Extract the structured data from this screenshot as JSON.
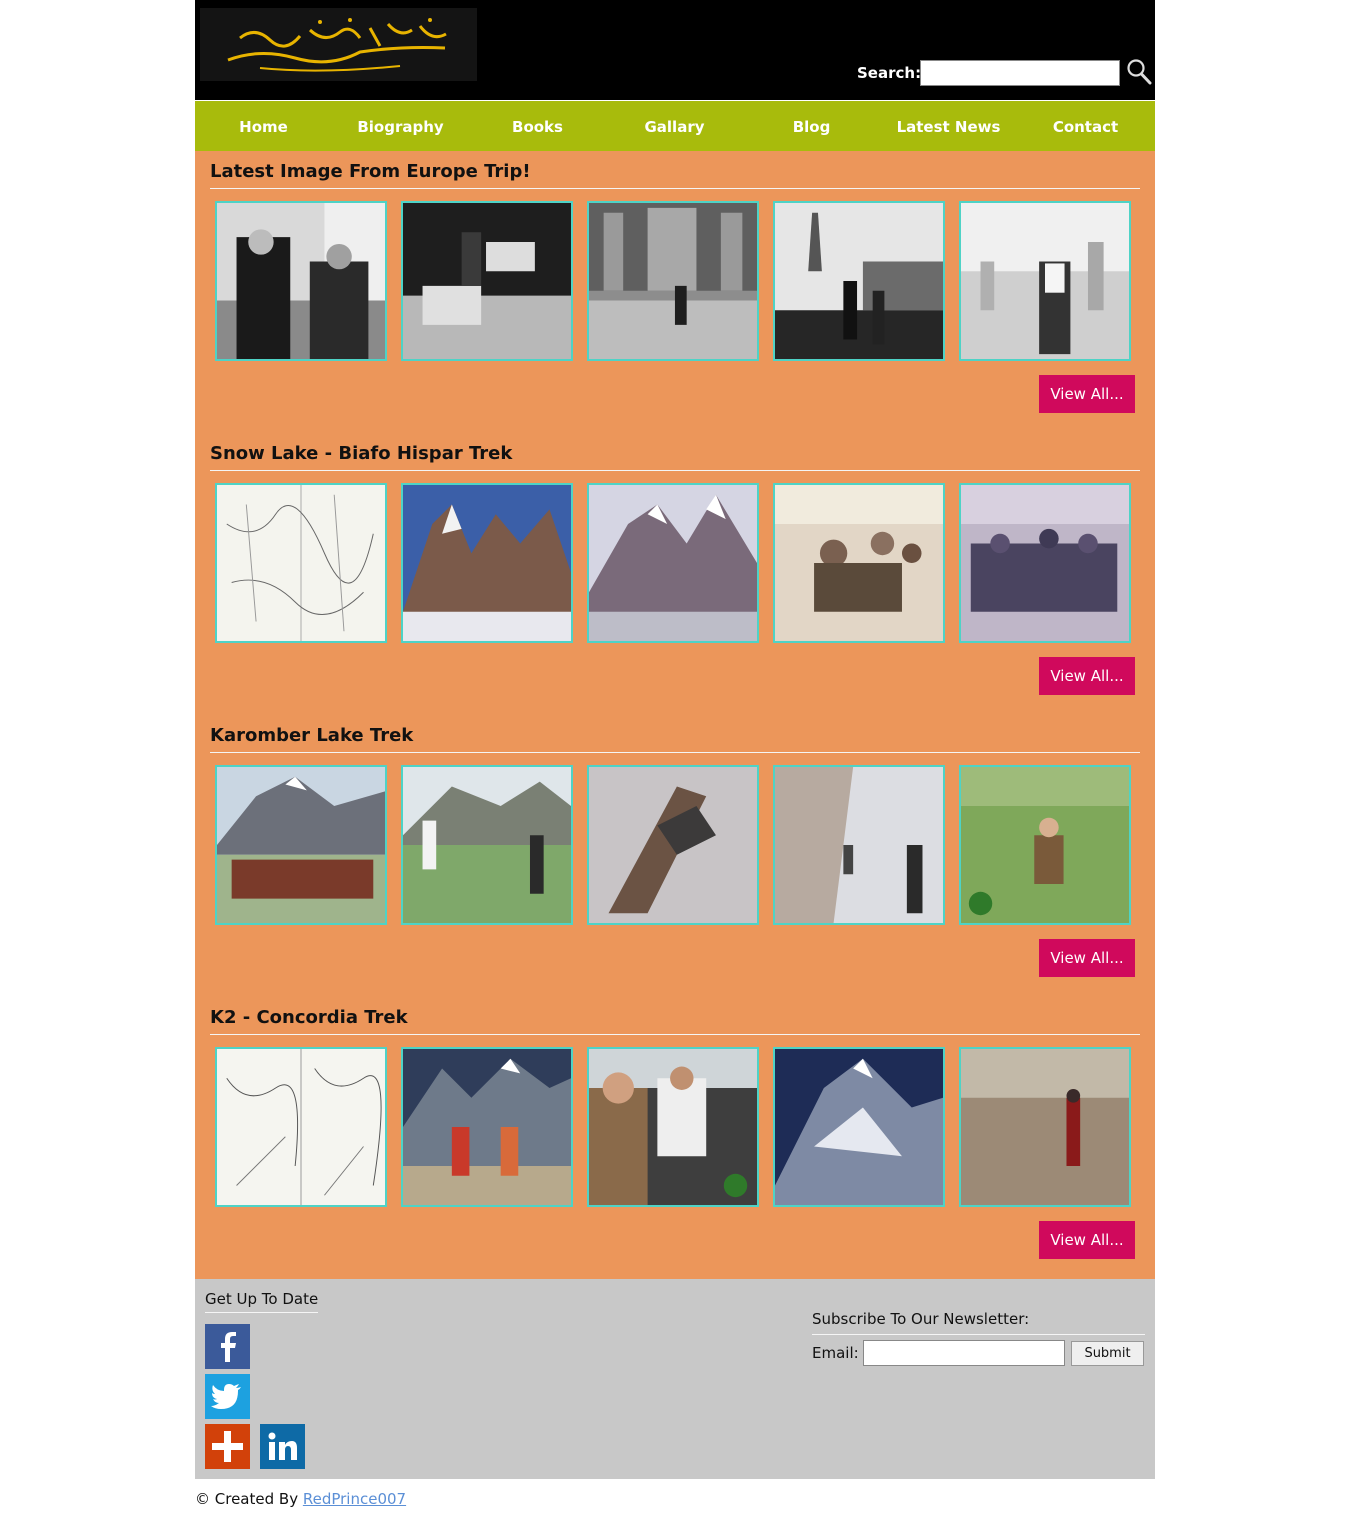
{
  "header": {
    "logo_alt": "مستنصر حسین تارڑ",
    "search_label": "Search:",
    "search_value": ""
  },
  "nav": {
    "items": [
      "Home",
      "Biography",
      "Books",
      "Gallary",
      "Blog",
      "Latest News",
      "Contact"
    ]
  },
  "sections": [
    {
      "title": "Latest Image From Europe Trip!",
      "view_all": "View All..."
    },
    {
      "title": "Snow Lake - Biafo Hispar Trek",
      "view_all": "View All..."
    },
    {
      "title": "Karomber Lake Trek",
      "view_all": "View All..."
    },
    {
      "title": "K2 - Concordia Trek",
      "view_all": "View All..."
    }
  ],
  "footer": {
    "social_title": "Get Up To Date",
    "social_icons": [
      "facebook-icon",
      "twitter-icon",
      "google-plus-icon",
      "linkedin-icon"
    ],
    "newsletter_title": "Subscribe To Our Newsletter:",
    "email_label": "Email:",
    "email_value": "",
    "submit_label": "Submit"
  },
  "credit": {
    "prefix": "© Created By",
    "link_text": "RedPrince007"
  },
  "colors": {
    "header_bg": "#000000",
    "nav_bg": "#a8bb0c",
    "main_bg": "#ec965a",
    "button_bg": "#d0095c",
    "thumb_border": "#4ed3c6",
    "footer_bg": "#c8c8c8",
    "logo_text": "#e8b400"
  }
}
